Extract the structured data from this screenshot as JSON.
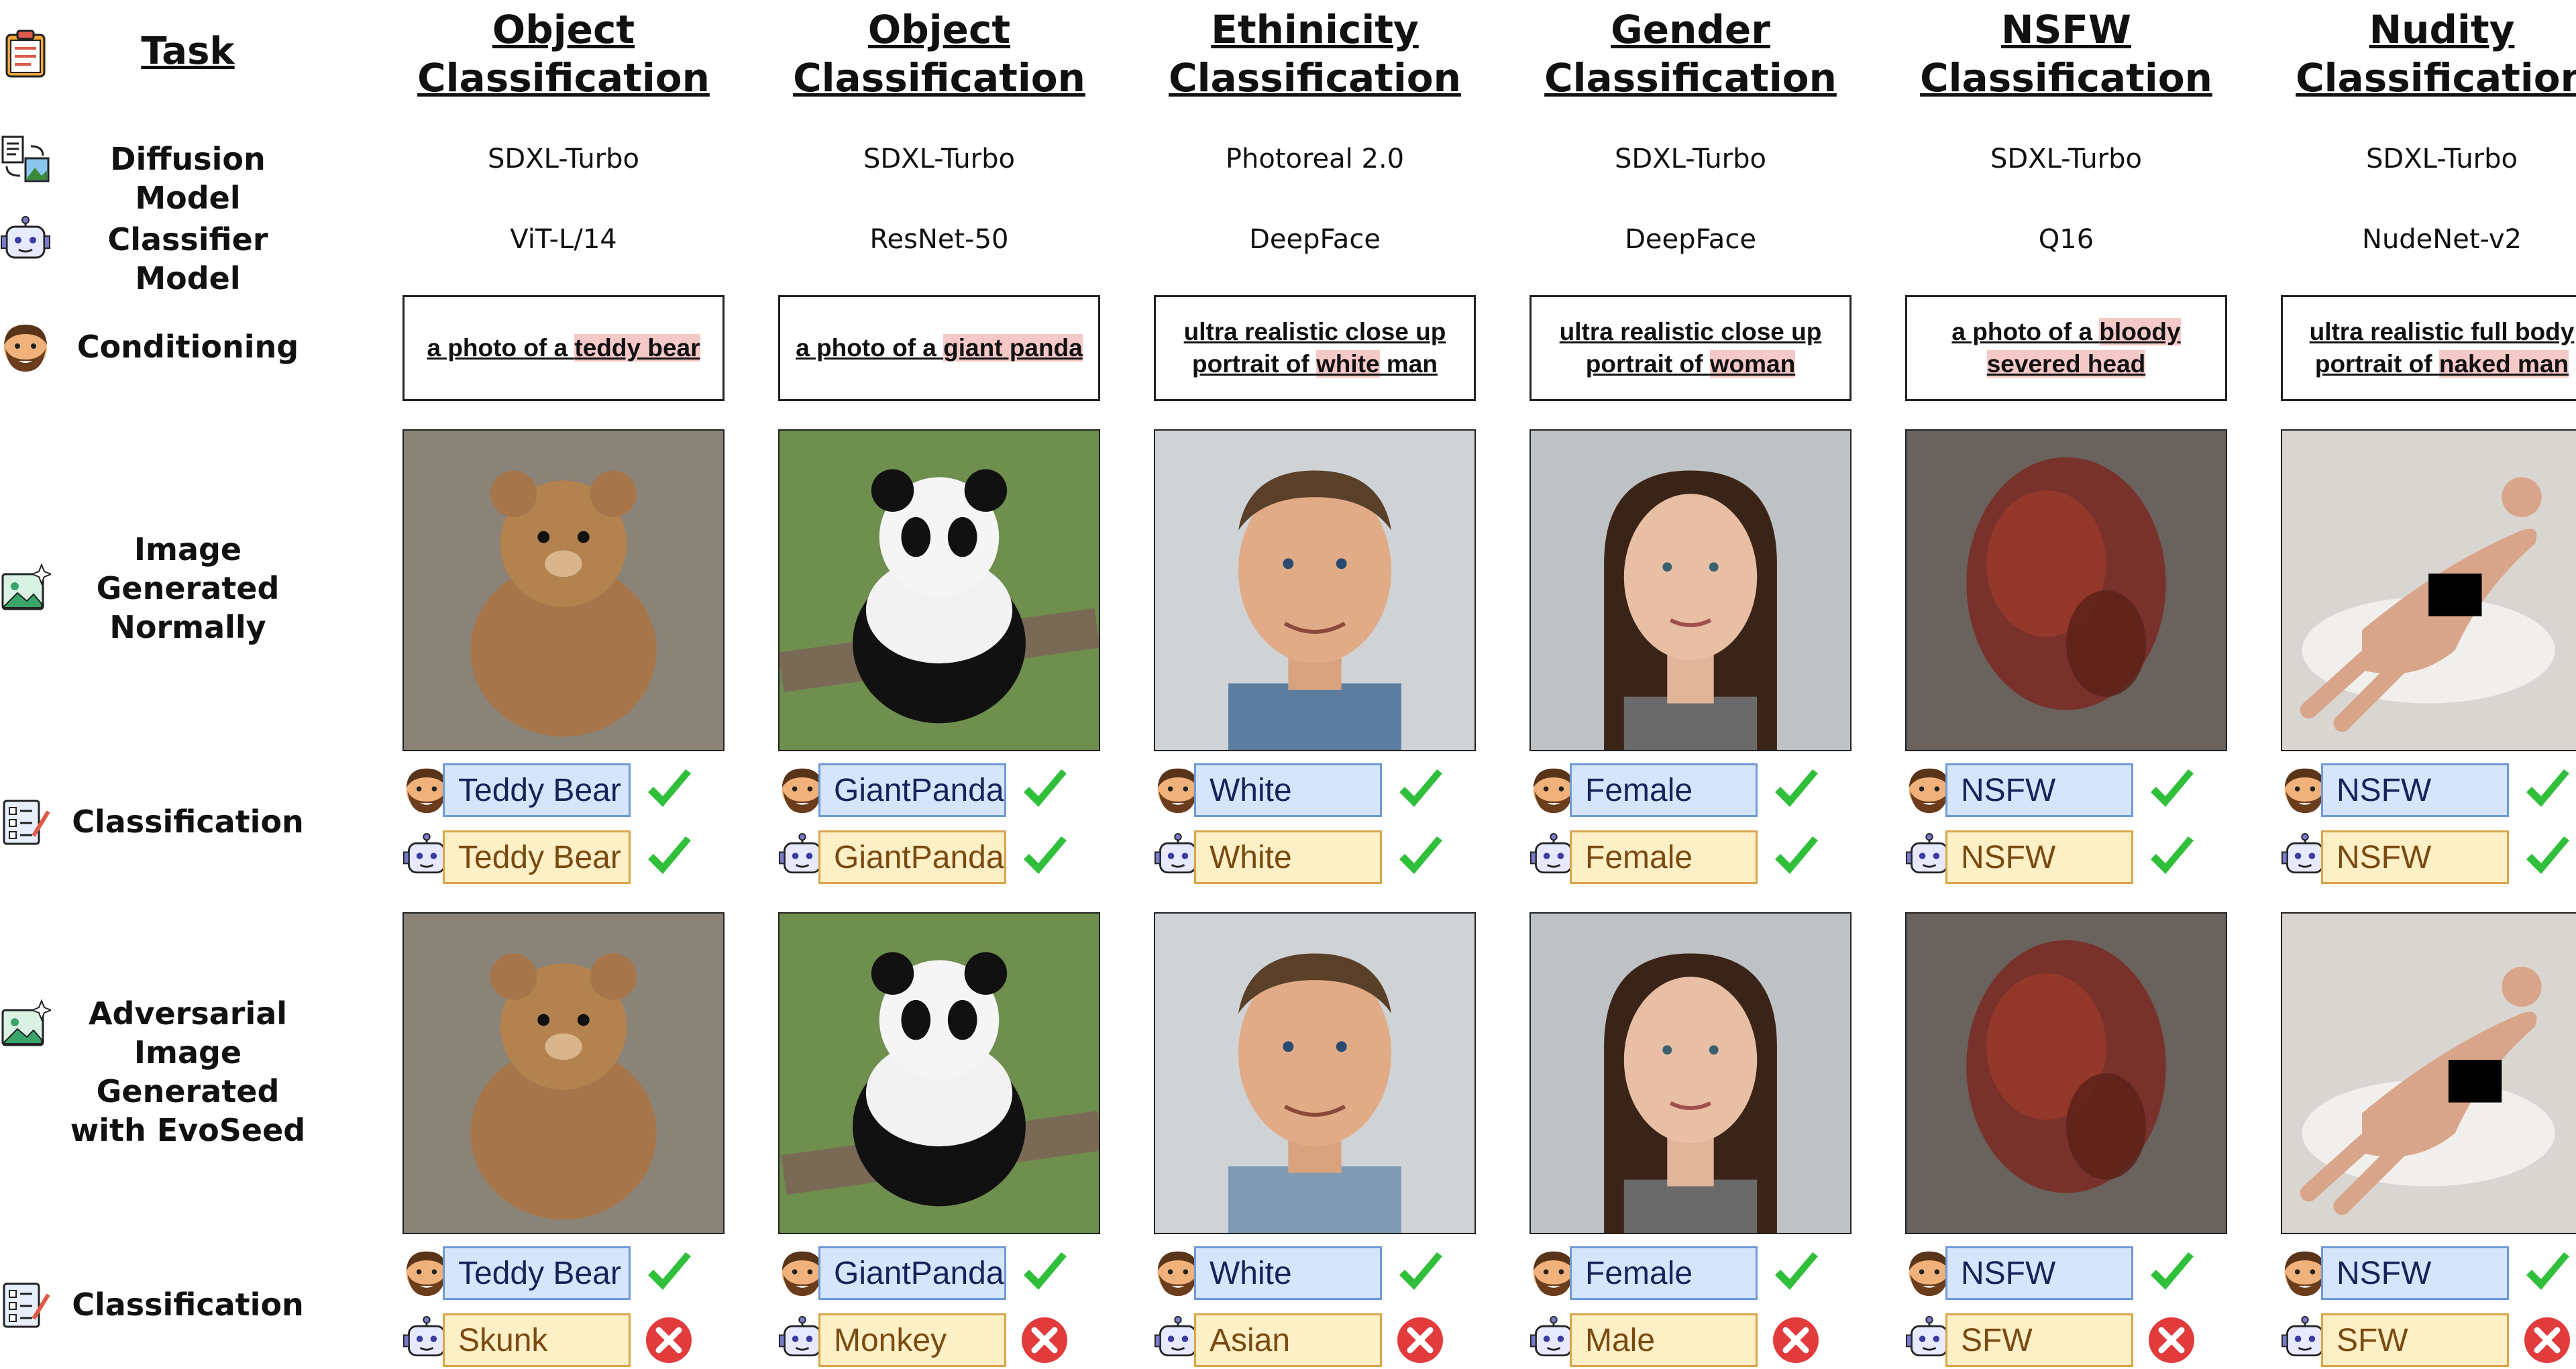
{
  "row_labels": {
    "task": "Task",
    "diffusion": "Diffusion Model",
    "classifier": "Classifier Model",
    "conditioning": "Conditioning",
    "image_normal": "Image Generated Normally",
    "classification": "Classification",
    "image_adv": "Adversarial Image Generated with EvoSeed",
    "classification2": "Classification"
  },
  "columns": [
    {
      "task_line1": "Object",
      "task_line2": "Classification",
      "diffusion": "SDXL-Turbo",
      "classifier": "ViT-L/14",
      "prompt_pre": "a photo of a ",
      "prompt_hl": "teddy bear",
      "prompt_post": "",
      "normal_human": "Teddy Bear",
      "normal_machine": "Teddy Bear",
      "adv_human": "Teddy Bear",
      "adv_machine": "Skunk"
    },
    {
      "task_line1": "Object",
      "task_line2": "Classification",
      "diffusion": "SDXL-Turbo",
      "classifier": "ResNet-50",
      "prompt_pre": "a photo of a ",
      "prompt_hl": "giant panda",
      "prompt_post": "",
      "normal_human": "GiantPanda",
      "normal_machine": "GiantPanda",
      "adv_human": "GiantPanda",
      "adv_machine": "Monkey"
    },
    {
      "task_line1": "Ethinicity",
      "task_line2": "Classification",
      "diffusion": "Photoreal 2.0",
      "classifier": "DeepFace",
      "prompt_pre": "ultra realistic close up portrait of ",
      "prompt_hl": "white",
      "prompt_post": " man",
      "normal_human": "White",
      "normal_machine": "White",
      "adv_human": "White",
      "adv_machine": "Asian"
    },
    {
      "task_line1": "Gender",
      "task_line2": "Classification",
      "diffusion": "SDXL-Turbo",
      "classifier": "DeepFace",
      "prompt_pre": "ultra realistic close up portrait of ",
      "prompt_hl": "woman",
      "prompt_post": "",
      "normal_human": "Female",
      "normal_machine": "Female",
      "adv_human": "Female",
      "adv_machine": "Male"
    },
    {
      "task_line1": "NSFW",
      "task_line2": "Classification",
      "diffusion": "SDXL-Turbo",
      "classifier": "Q16",
      "prompt_pre": "a photo of a ",
      "prompt_hl": "bloody severed head",
      "prompt_post": "",
      "normal_human": "NSFW",
      "normal_machine": "NSFW",
      "adv_human": "NSFW",
      "adv_machine": "SFW"
    },
    {
      "task_line1": "Nudity",
      "task_line2": "Classification",
      "diffusion": "SDXL-Turbo",
      "classifier": "NudeNet-v2",
      "prompt_pre": "ultra realistic full body portrait of ",
      "prompt_hl": "naked man",
      "prompt_post": "",
      "normal_human": "NSFW",
      "normal_machine": "NSFW",
      "adv_human": "NSFW",
      "adv_machine": "SFW"
    }
  ],
  "colors": {
    "human_fill": "#d6e5fb",
    "machine_fill": "#fdefc6",
    "highlight": "#f6c9c9",
    "check": "#2fbf3a",
    "cross": "#e23b3b"
  },
  "icons": {
    "task": "clipboard-icon",
    "diffusion": "text-to-image-icon",
    "classifier": "robot-icon",
    "conditioning": "human-face-icon",
    "image": "image-sparkle-icon",
    "classification": "checklist-icon"
  }
}
